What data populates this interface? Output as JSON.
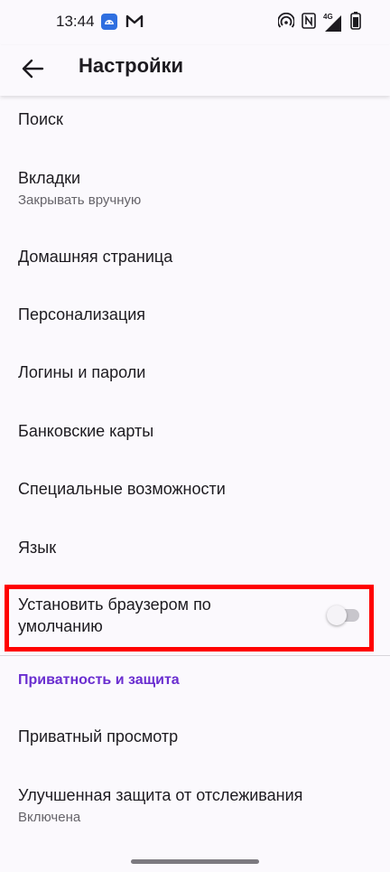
{
  "status_bar": {
    "time": "13:44",
    "left_icons": [
      "android-app-icon",
      "gmail-icon"
    ],
    "right_icons": [
      "hotspot-icon",
      "nfc-icon",
      "signal-4g-icon",
      "battery-icon"
    ],
    "network": "4G"
  },
  "appbar": {
    "title": "Настройки",
    "back_icon": "arrow-back-icon"
  },
  "items": [
    {
      "title": "Поиск"
    },
    {
      "title": "Вкладки",
      "subtitle": "Закрывать вручную"
    },
    {
      "title": "Домашняя страница"
    },
    {
      "title": "Персонализация"
    },
    {
      "title": "Логины и пароли"
    },
    {
      "title": "Банковские карты"
    },
    {
      "title": "Специальные возможности"
    },
    {
      "title": "Язык"
    },
    {
      "title_line1": "Установить браузером по",
      "title_line2": "умолчанию",
      "toggle_on": false
    }
  ],
  "section": {
    "header": "Приватность и защита",
    "items": [
      {
        "title": "Приватный просмотр"
      },
      {
        "title": "Улучшенная защита от отслеживания",
        "subtitle": "Включена"
      }
    ]
  },
  "colors": {
    "background": "#fbf9fd",
    "accent": "#6a2ed0",
    "highlight": "#ff0000"
  }
}
